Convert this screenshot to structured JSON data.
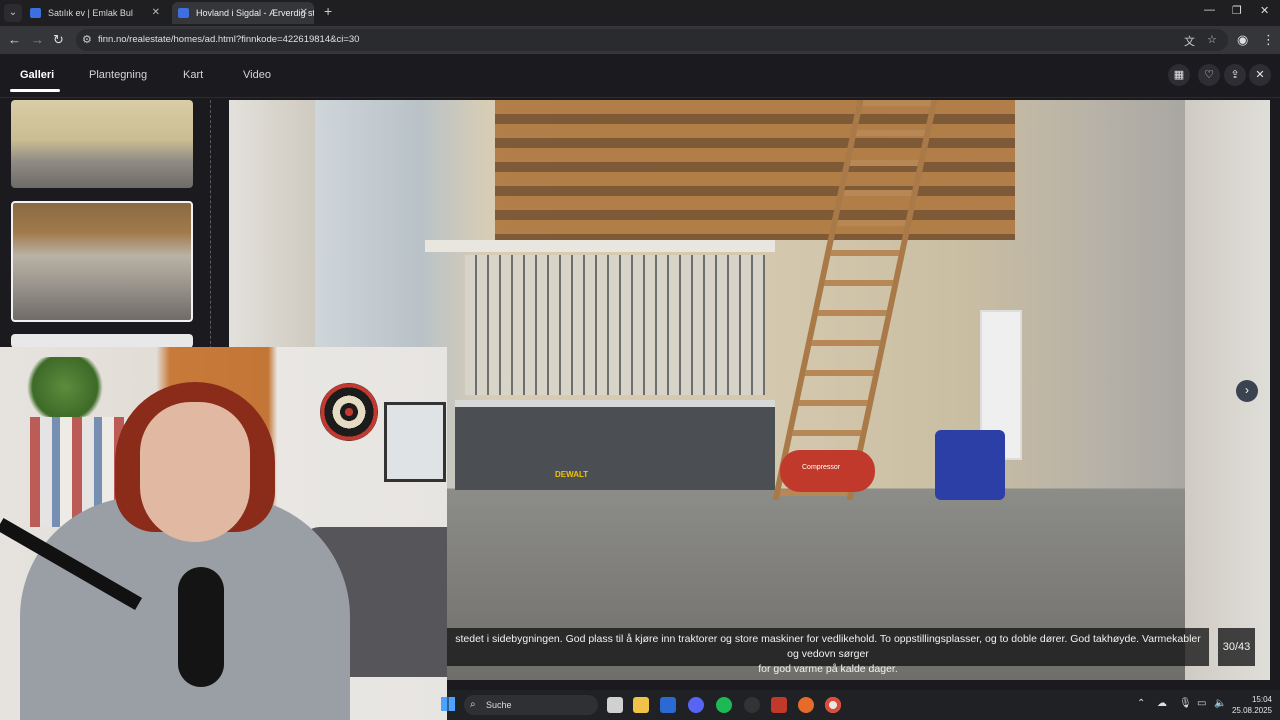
{
  "browser": {
    "tabs": [
      {
        "title": "Satılık ev | Emlak Bul",
        "active": false
      },
      {
        "title": "Hovland i Sigdal - Ærverdig sto",
        "active": true
      }
    ],
    "url": "finn.no/realestate/homes/ad.html?finnkode=422619814&ci=30"
  },
  "gallery": {
    "tabs": [
      {
        "label": "Galleri",
        "active": true
      },
      {
        "label": "Plantegning",
        "active": false
      },
      {
        "label": "Kart",
        "active": false
      },
      {
        "label": "Video",
        "active": false
      }
    ],
    "caption_line1": "stedet i sidebygningen. God plass til å kjøre inn traktorer og store maskiner for vedlikehold. To oppstillingsplasser, og to doble dører. God takhøyde. Varmekabler og vedovn sørger",
    "caption_line2": "for god varme på kalde dager.",
    "counter": "30/43",
    "image_brand_label": "DEWALT",
    "image_compressor_label": "Compressor"
  },
  "taskbar": {
    "search_placeholder": "Suche",
    "time": "15:04",
    "date": "25.08.2025"
  },
  "icons": {
    "accent": "#3d6fe0"
  }
}
